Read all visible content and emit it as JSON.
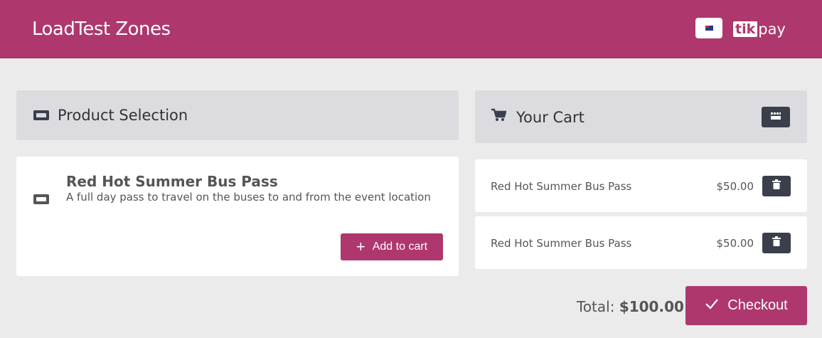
{
  "header": {
    "app_title": "LoadTest Zones",
    "locale_icon": "flag-au-icon",
    "logo_box": "tik",
    "logo_text": "pay"
  },
  "product_selection": {
    "title": "Product Selection",
    "icon": "ticket-icon",
    "products": [
      {
        "name": "Red Hot Summer Bus Pass",
        "description": "A full day pass to travel on the buses to and from the event location",
        "add_label": "Add to cart"
      }
    ]
  },
  "cart": {
    "title": "Your Cart",
    "icon": "cart-icon",
    "items": [
      {
        "name": "Red Hot Summer Bus Pass",
        "price": "$50.00"
      },
      {
        "name": "Red Hot Summer Bus Pass",
        "price": "$50.00"
      }
    ],
    "total_label": "Total:",
    "total_value": "$100.00",
    "checkout_label": "Checkout"
  },
  "colors": {
    "brand": "#ae376d",
    "dark_button": "#3a3f4b",
    "panel_header": "#dcdce0",
    "background": "#ebebeb"
  }
}
